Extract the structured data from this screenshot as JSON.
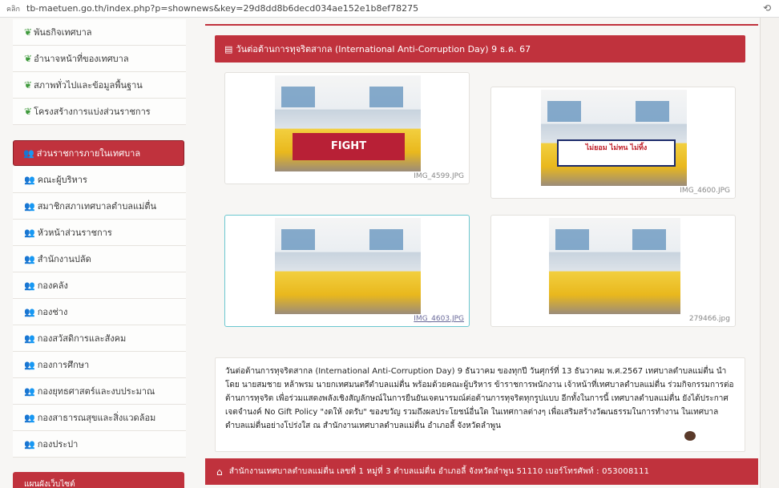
{
  "address_bar": {
    "label": "คลิก",
    "url": "tb-maetuen.go.th/index.php?p=shownews&key=29d8dd8b6decd034ae152e1b8ef78275",
    "ext_icon": "extension-icon"
  },
  "sidebar": {
    "top_items": [
      "พันธกิจเทศบาล",
      "อำนาจหน้าที่ของเทศบาล",
      "สภาพทั่วไปและข้อมูลพื้นฐาน",
      "โครงสร้างการแบ่งส่วนราชการ"
    ],
    "section_title": "ส่วนราชการภายในเทศบาล",
    "section_items": [
      "คณะผู้บริหาร",
      "สมาชิกสภาเทศบาลตำบลแม่ตื่น",
      "หัวหน้าส่วนราชการ",
      "สำนักงานปลัด",
      "กองคลัง",
      "กองช่าง",
      "กองสวัสดิการและสังคม",
      "กองการศึกษา",
      "กองยุทธศาสตร์และงบประมาณ",
      "กองสาธารณสุขและสิ่งแวดล้อม",
      "กองประปา"
    ],
    "bottom_header": "แผนผังเว็บไซต์"
  },
  "news": {
    "title": "วันต่อต้านการทุจริตสากล (International Anti-Corruption Day) 9 ธ.ค. 67",
    "photos": [
      {
        "caption": "IMG_4599.JPG",
        "banner": "FIGHT"
      },
      {
        "caption": "IMG_4600.JPG",
        "banner": "ไม่ยอม ไม่ทน ไม่ทิ้ง"
      },
      {
        "caption": "IMG_4603.JPG",
        "banner": ""
      },
      {
        "caption": "279466.jpg",
        "banner": ""
      }
    ],
    "body": "วันต่อต้านการทุจริตสากล (International Anti-Corruption Day) 9 ธันวาคม ของทุกปี วันศุกร์ที่ 13 ธันวาคม พ.ศ.2567 เทศบาลตำบลแม่ตื่น นำโดย นายสมชาย หล้าพรม นายกเทศมนตรีตำบลแม่ตื่น พร้อมด้วยคณะผู้บริหาร ข้าราชการพนักงาน เจ้าหน้าที่เทศบาลตำบลแม่ตื่น ร่วมกิจกรรมการต่อต้านการทุจริต เพื่อร่วมแสดงพลังเชิงสัญลักษณ์ในการยืนยันเจตนารมณ์ต่อต้านการทุจริตทุกรูปแบบ อีกทั้งในการนี้ เทศบาลตำบลแม่ตื่น ยังได้ประกาศเจตจำนงค์ No Gift Policy \"งดให้ งดรับ\" ของขวัญ รวมถึงผลประโยชน์อื่นใด ในเทศกาลต่างๆ เพื่อเสริมสร้างวัฒนธรรมในการทำงาน ในเทศบาลตำบลแม่ตื่นอย่างโปร่งใส ณ สำนักงานเทศบาลตำบลแม่ตื่น อำเภอลี้ จังหวัดลำพูน"
  },
  "footer": {
    "text": "สำนักงานเทศบาลตำบลแม่ตื่น เลขที่ 1 หมู่ที่ 3 ตำบลแม่ตื่น อำเภอลี้ จังหวัดลำพูน 51110 เบอร์โทรศัพท์ : 053008111"
  },
  "colors": {
    "brand_red": "#c0323d",
    "leaf_green": "#3f9a3c",
    "active_border": "#6bc7cf"
  }
}
